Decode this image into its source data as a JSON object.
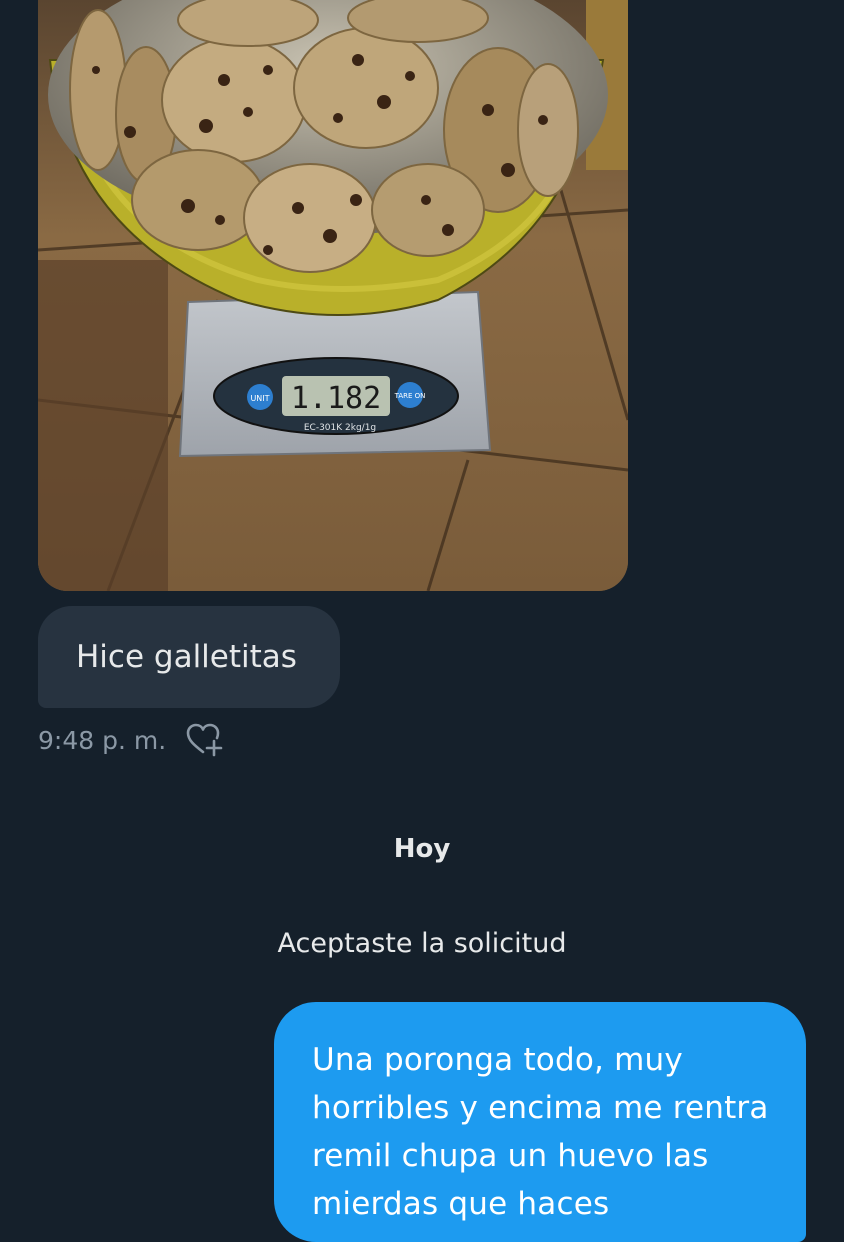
{
  "conversation": {
    "incoming_image": {
      "scale_display": "1.182",
      "scale_model": "EC-301K  2kg/1g",
      "scale_left_button": "UNIT",
      "scale_right_button": "TARE ON"
    },
    "incoming_message": {
      "text": "Hice galletitas",
      "time": "9:48 p. m.",
      "reaction_icon": "heart-plus-icon"
    },
    "day_separator": "Hoy",
    "system_message": "Aceptaste la solicitud",
    "outgoing_message": {
      "text": "Una poronga todo, muy horribles y encima me rentra remil chupa un huevo las mierdas que haces"
    }
  },
  "colors": {
    "background": "#15202b",
    "incoming_bubble": "#273340",
    "outgoing_bubble": "#1d9bf0",
    "muted_text": "#8b98a5"
  }
}
